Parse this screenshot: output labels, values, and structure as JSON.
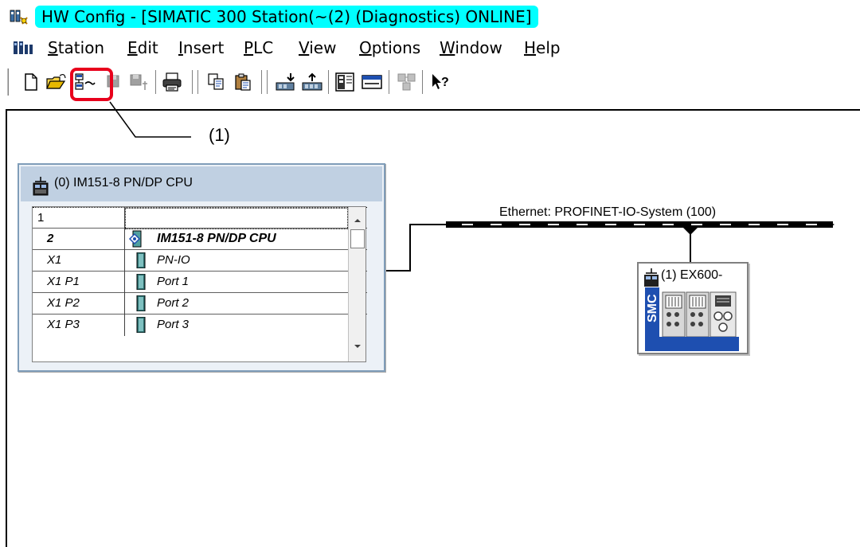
{
  "window": {
    "title": "HW Config - [SIMATIC 300 Station(~(2) (Diagnostics)  ONLINE]"
  },
  "menu": {
    "items": [
      {
        "label": "Station",
        "accel": "S"
      },
      {
        "label": "Edit",
        "accel": "E"
      },
      {
        "label": "Insert",
        "accel": "I"
      },
      {
        "label": "PLC",
        "accel": "P"
      },
      {
        "label": "View",
        "accel": "V"
      },
      {
        "label": "Options",
        "accel": "O"
      },
      {
        "label": "Window",
        "accel": "W"
      },
      {
        "label": "Help",
        "accel": "H"
      }
    ]
  },
  "toolbar": {
    "buttons": [
      "new-icon",
      "open-icon",
      "online-offline-icon",
      "save-icon",
      "save-compile-icon",
      "print-icon",
      "copy-icon",
      "paste-icon",
      "download-icon",
      "upload-icon",
      "catalog-icon",
      "network-view-icon",
      "help-context-icon"
    ],
    "highlight_color": "#e8001c"
  },
  "callout": {
    "label": "(1)"
  },
  "rack": {
    "title": "(0) IM151-8 PN/DP CPU",
    "rows": [
      {
        "slot": "1",
        "module": ""
      },
      {
        "slot": "2",
        "module": "IM151-8 PN/DP CPU"
      },
      {
        "slot": "X1",
        "module": "PN-IO"
      },
      {
        "slot": "X1 P1",
        "module": "Port 1"
      },
      {
        "slot": "X1 P2",
        "module": "Port 2"
      },
      {
        "slot": "X1 P3",
        "module": "Port 3"
      }
    ]
  },
  "network": {
    "label": "Ethernet: PROFINET-IO-System (100)"
  },
  "device": {
    "name": "(1) EX600-",
    "brand": "SMC"
  },
  "colors": {
    "title_highlight": "#00ffff",
    "rack_header": "#c0d0e2"
  }
}
